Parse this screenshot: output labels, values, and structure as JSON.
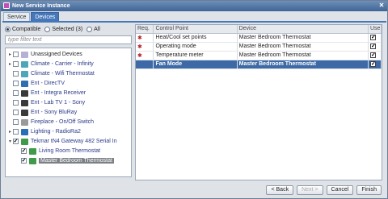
{
  "window": {
    "title": "New Service Instance",
    "close_glyph": "✕"
  },
  "tabs": [
    {
      "label": "Service"
    },
    {
      "label": "Devices",
      "active": true
    }
  ],
  "filter": {
    "radios": [
      {
        "label": "Compatible",
        "checked": true
      },
      {
        "label": "Selected (3)",
        "checked": false
      },
      {
        "label": "All",
        "checked": false
      }
    ],
    "placeholder": "type filter text"
  },
  "tree": [
    {
      "label": "Unassigned Devices",
      "twisty": "▸",
      "checked": false,
      "icon_color": "#b7b0d6",
      "plain": true
    },
    {
      "label": "Climate - Carrier - Infinity",
      "twisty": "▸",
      "checked": false,
      "icon_color": "#4aa6b8"
    },
    {
      "label": "Climate - Wifi Thermostat",
      "twisty": "",
      "checked": false,
      "icon_color": "#4aa6b8"
    },
    {
      "label": "Ent - DirecTV",
      "twisty": "",
      "checked": false,
      "icon_color": "#2f6fb0"
    },
    {
      "label": "Ent -  Integra Receiver",
      "twisty": "",
      "checked": false,
      "icon_color": "#3a3a3a"
    },
    {
      "label": "Ent - Lab TV 1 - Sony",
      "twisty": "",
      "checked": false,
      "icon_color": "#3a3a3a"
    },
    {
      "label": "Ent - Sony BluRay",
      "twisty": "",
      "checked": false,
      "icon_color": "#3a3a3a"
    },
    {
      "label": "Fireplace - On/Off Switch",
      "twisty": "",
      "checked": false,
      "icon_color": "#9a9a9a"
    },
    {
      "label": "Lighting - RadioRa2",
      "twisty": "▸",
      "checked": false,
      "icon_color": "#2a6db8"
    },
    {
      "label": "Tekmar tN4 Gateway 482 Serial In",
      "twisty": "▾",
      "checked": true,
      "icon_color": "#3f9a4a"
    },
    {
      "label": "Living Room Thermostat",
      "twisty": "",
      "checked": true,
      "icon_color": "#3f9a4a",
      "indent": 1
    },
    {
      "label": "Master Bedroom Thermostat",
      "twisty": "",
      "checked": true,
      "icon_color": "#3f9a4a",
      "indent": 1,
      "selected": true
    }
  ],
  "table": {
    "headers": {
      "req": "Req.",
      "control": "Control Point",
      "device": "Device",
      "use": "Use"
    },
    "rows": [
      {
        "req": "✱",
        "control": "Heat/Cool set points",
        "device": "Master Bedroom Thermostat",
        "use": true
      },
      {
        "req": "✱",
        "control": "Operating mode",
        "device": "Master Bedroom Thermostat",
        "use": true
      },
      {
        "req": "✱",
        "control": "Temperature meter",
        "device": "Master Bedroom Thermostat",
        "use": true
      },
      {
        "req": "",
        "control": "Fan Mode",
        "device": "Master Bedroom Thermostat",
        "use": true,
        "selected": true
      }
    ]
  },
  "buttons": {
    "back": "< Back",
    "next": "Next >",
    "cancel": "Cancel",
    "finish": "Finish"
  }
}
